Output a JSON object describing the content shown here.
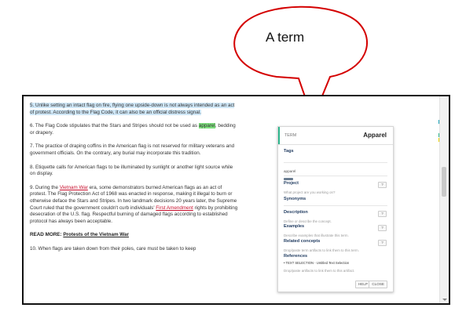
{
  "callout": {
    "text": "A term",
    "stroke": "#d40000"
  },
  "article": {
    "p5": "5. Unlike setting an intact flag on fire, flying one upside-down is not always intended as an act of protest. According to the Flag Code, it can also be an official distress signal.",
    "p6_pre": "6. The Flag Code stipulates that the Stars and Stripes should not be used as ",
    "p6_hl": "apparel",
    "p6_post": ", bedding or drapery.",
    "p7": "7. The practice of draping coffins in the American flag is not reserved for military veterans and government officials. On the contrary, any burial may incorporate this tradition.",
    "p8": "8. Etiquette calls for American flags to be illuminated by sunlight or another light source while on display.",
    "p9_pre": "9. During the ",
    "p9_link1": "Vietnam War",
    "p9_mid": " era, some demonstrators burned American flags as an act of protest. The Flag Protection Act of 1968 was enacted in response, making it illegal to burn or otherwise deface the Stars and Stripes. In two landmark decisions 20 years later, the Supreme Court ruled that the government couldn't curb individuals' ",
    "p9_link2": "First Amendment",
    "p9_post": " rights by prohibiting desecration of the U.S. flag. Respectful burning of damaged flags according to established protocol has always been acceptable.",
    "readmore_label": "READ MORE: ",
    "readmore_link": "Protests of the Vietnam War",
    "p10": "10. When flags are taken down from their poles, care must be taken to keep"
  },
  "panel": {
    "kind": "TERM",
    "title": "Apparel",
    "tags_label": "Tags",
    "tag_value": "apparel",
    "project_label": "Project",
    "project_hint": "What project are you working on?",
    "synonyms_label": "Synonyms",
    "description_label": "Description",
    "description_hint": "Define or describe the concept.",
    "examples_label": "Examples",
    "examples_hint": "Describe examples that illustrate this term.",
    "related_label": "Related concepts",
    "related_hint": "Drop/paste term artifacts to link them to this term.",
    "references_label": "References",
    "reference_item": "• TEXT SELECTION - Untitled Text Selection",
    "references_hint": "Drop/paste artifacts to link them to this artifact.",
    "help_q": "?",
    "help_button": "HELP",
    "close_button": "CLOSE"
  },
  "colors": {
    "accent": "#2db58c",
    "highlight": "#cfe7f7",
    "green": "#7ee07e",
    "link": "#c8102e",
    "marker1": "#1fa3b8",
    "marker2": "#2db58c",
    "marker3": "#e8d000"
  }
}
